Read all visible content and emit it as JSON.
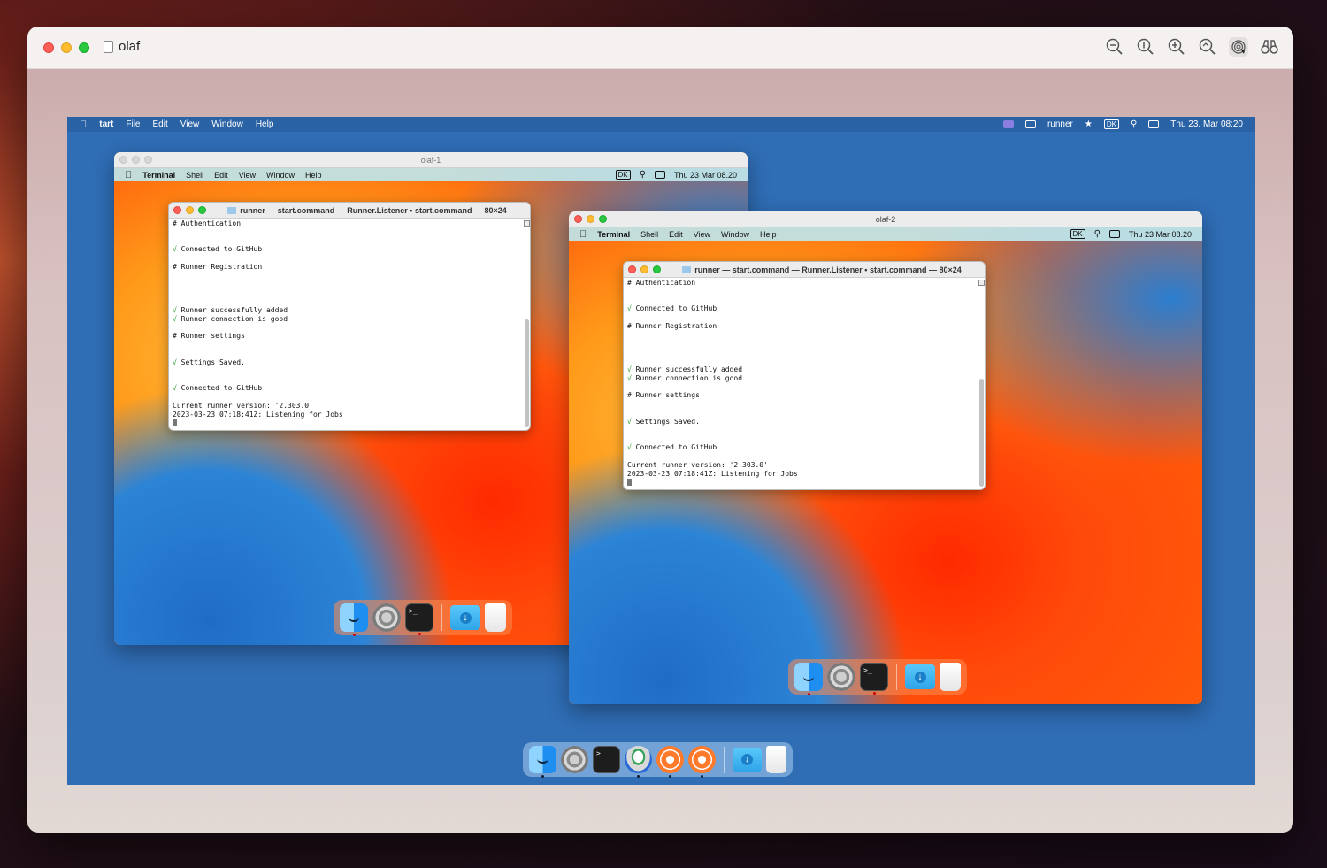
{
  "host": {
    "title": "olaf",
    "tools": [
      "zoom-out-icon",
      "actual-size-icon",
      "zoom-in-icon",
      "zoom-to-fit-icon",
      "touch-id-icon",
      "binoculars-icon"
    ]
  },
  "vm_menubar": {
    "app": "tart",
    "menus": [
      "File",
      "Edit",
      "View",
      "Window",
      "Help"
    ],
    "user": "runner",
    "input": "DK",
    "datetime": "Thu 23. Mar  08:20"
  },
  "guests": [
    {
      "window_title": "olaf-1",
      "menubar": {
        "app": "Terminal",
        "menus": [
          "Shell",
          "Edit",
          "View",
          "Window",
          "Help"
        ],
        "input": "DK",
        "datetime": "Thu 23 Mar  08.20"
      },
      "terminal": {
        "title": "runner — start.command — Runner.Listener • start.command — 80×24"
      }
    },
    {
      "window_title": "olaf-2",
      "menubar": {
        "app": "Terminal",
        "menus": [
          "Shell",
          "Edit",
          "View",
          "Window",
          "Help"
        ],
        "input": "DK",
        "datetime": "Thu 23 Mar  08.20"
      },
      "terminal": {
        "title": "runner — start.command — Runner.Listener • start.command — 80×24"
      }
    }
  ],
  "terminal_lines": [
    "# Authentication",
    "",
    "",
    "Connected to GitHub",
    "",
    "# Runner Registration",
    "",
    "",
    "",
    "",
    "Runner successfully added",
    "Runner connection is good",
    "",
    "# Runner settings",
    "",
    "",
    "Settings Saved.",
    "",
    "",
    "Connected to GitHub",
    "",
    "Current runner version: '2.303.0'",
    "2023-03-23 07:18:41Z: Listening for Jobs"
  ],
  "terminal_checked": [
    3,
    10,
    11,
    16,
    19
  ],
  "terminal_prompt": ">_",
  "colors": {
    "vm_desktop": "#2f6db5",
    "check": "#2a9d2a",
    "close": "#fe5f57",
    "minimize": "#febc2e",
    "zoom": "#28c840"
  }
}
